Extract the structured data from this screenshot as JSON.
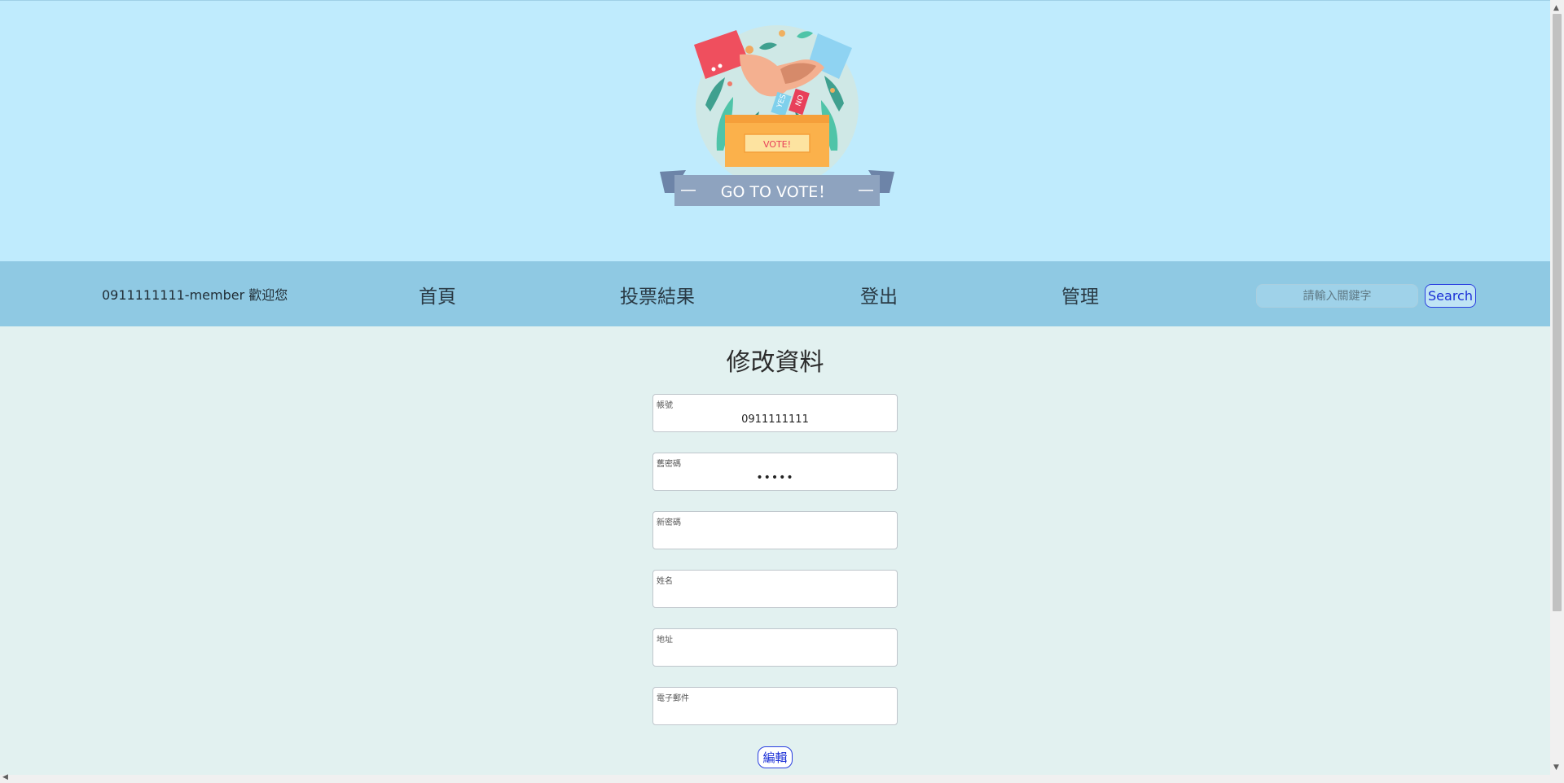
{
  "logo": {
    "banner_text": "GO TO VOTE！",
    "box_text": "VOTE!",
    "ballot_yes": "YES",
    "ballot_no": "NO"
  },
  "nav": {
    "welcome": "0911111111-member 歡迎您",
    "home": "首頁",
    "results": "投票結果",
    "logout": "登出",
    "admin": "管理",
    "search_placeholder": "請輸入關鍵字",
    "search_button": "Search"
  },
  "form": {
    "title": "修改資料",
    "fields": [
      {
        "label": "帳號",
        "value": "0911111111"
      },
      {
        "label": "舊密碼",
        "value": "•••••"
      },
      {
        "label": "新密碼",
        "value": ""
      },
      {
        "label": "姓名",
        "value": ""
      },
      {
        "label": "地址",
        "value": ""
      },
      {
        "label": "電子郵件",
        "value": ""
      }
    ],
    "edit_button": "編輯"
  },
  "colors": {
    "header_bg": "#bfebfd",
    "nav_bg": "#8fc9e3",
    "content_bg": "#e2f1f0",
    "button_accent": "#1a2fd6"
  }
}
